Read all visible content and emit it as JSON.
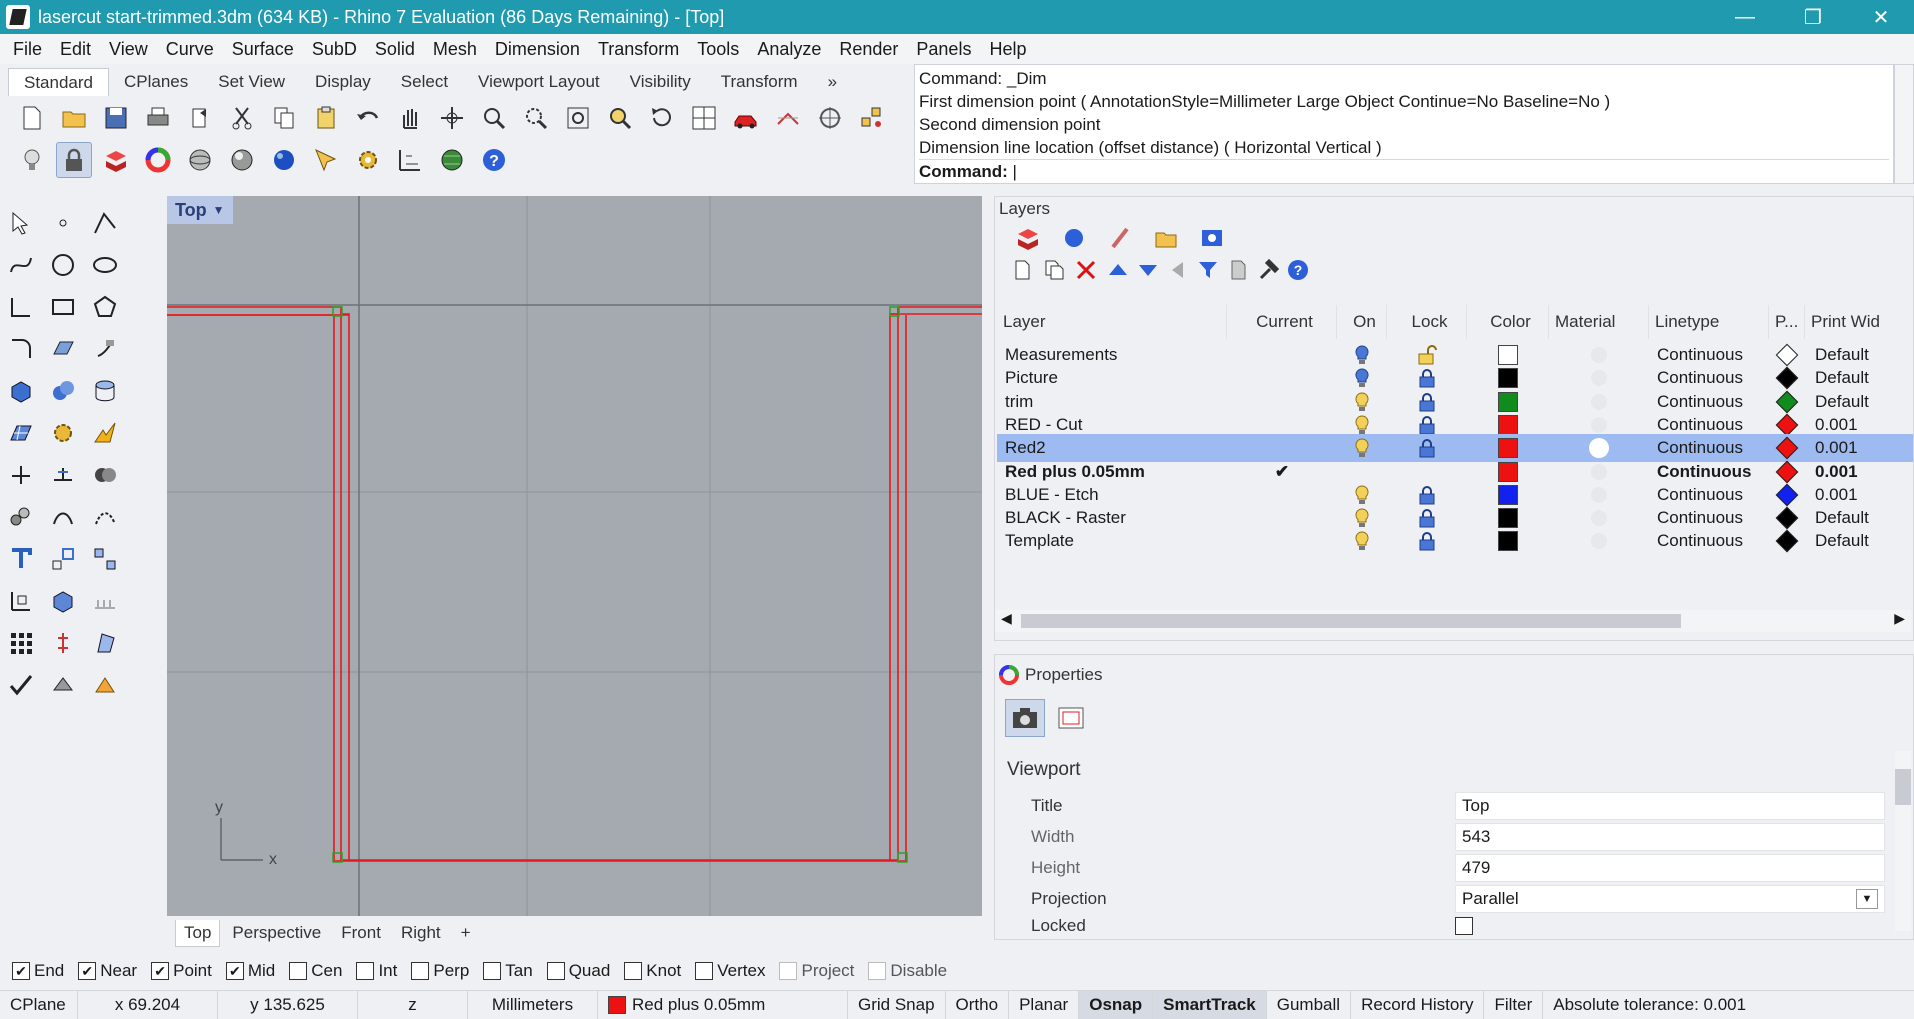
{
  "window": {
    "title": "lasercut start-trimmed.3dm (634 KB) - Rhino 7 Evaluation (86 Days Remaining) - [Top]",
    "min": "—",
    "restore": "❐",
    "close": "✕"
  },
  "menu": [
    "File",
    "Edit",
    "View",
    "Curve",
    "Surface",
    "SubD",
    "Solid",
    "Mesh",
    "Dimension",
    "Transform",
    "Tools",
    "Analyze",
    "Render",
    "Panels",
    "Help"
  ],
  "toolbar_tabs": [
    "Standard",
    "CPlanes",
    "Set View",
    "Display",
    "Select",
    "Viewport Layout",
    "Visibility",
    "Transform"
  ],
  "toolbar_overflow": "»",
  "command": {
    "history": [
      "Command: _Dim",
      "First dimension point ( AnnotationStyle=Millimeter Large  Object  Continue=No  Baseline=No )",
      "Second dimension point",
      "Dimension line location (offset distance) ( Horizontal  Vertical )"
    ],
    "prompt": "Command:"
  },
  "viewport": {
    "name": "Top",
    "axis_x": "x",
    "axis_y": "y"
  },
  "viewport_tabs": [
    "Top",
    "Perspective",
    "Front",
    "Right"
  ],
  "viewport_tab_add": "+",
  "layers": {
    "title": "Layers",
    "columns": [
      "Layer",
      "Current",
      "On",
      "Lock",
      "Color",
      "Material",
      "Linetype",
      "P...",
      "Print Wid"
    ],
    "rows": [
      {
        "name": "Measurements",
        "current": "",
        "on": "on-blue",
        "lock": "unlocked",
        "color": "#ffffff",
        "material": "",
        "linetype": "Continuous",
        "print_color": "#ffffff",
        "print_width": "Default"
      },
      {
        "name": "Picture",
        "current": "",
        "on": "on-blue",
        "lock": "locked",
        "color": "#000000",
        "material": "",
        "linetype": "Continuous",
        "print_color": "#000000",
        "print_width": "Default"
      },
      {
        "name": "trim",
        "current": "",
        "on": "on",
        "lock": "locked",
        "color": "#118a1e",
        "material": "",
        "linetype": "Continuous",
        "print_color": "#118a1e",
        "print_width": "Default"
      },
      {
        "name": "RED - Cut",
        "current": "",
        "on": "on",
        "lock": "locked",
        "color": "#ee1111",
        "material": "",
        "linetype": "Continuous",
        "print_color": "#ee1111",
        "print_width": "0.001"
      },
      {
        "name": "Red2",
        "current": "",
        "on": "on",
        "lock": "locked",
        "color": "#ee1111",
        "material": "white",
        "linetype": "Continuous",
        "print_color": "#ee1111",
        "print_width": "0.001"
      },
      {
        "name": "Red plus 0.05mm",
        "current": "✔",
        "on": "",
        "lock": "",
        "color": "#ee1111",
        "material": "",
        "linetype": "Continuous",
        "print_color": "#ee1111",
        "print_width": "0.001"
      },
      {
        "name": "BLUE - Etch",
        "current": "",
        "on": "on",
        "lock": "locked",
        "color": "#1122ee",
        "material": "",
        "linetype": "Continuous",
        "print_color": "#1122ee",
        "print_width": "0.001"
      },
      {
        "name": "BLACK - Raster",
        "current": "",
        "on": "on",
        "lock": "locked",
        "color": "#000000",
        "material": "",
        "linetype": "Continuous",
        "print_color": "#000000",
        "print_width": "Default"
      },
      {
        "name": "Template",
        "current": "",
        "on": "on",
        "lock": "locked",
        "color": "#000000",
        "material": "",
        "linetype": "Continuous",
        "print_color": "#000000",
        "print_width": "Default"
      }
    ]
  },
  "properties": {
    "title": "Properties",
    "section": "Viewport",
    "fields": [
      {
        "label": "Title",
        "value": "Top"
      },
      {
        "label": "Width",
        "value": "543"
      },
      {
        "label": "Height",
        "value": "479"
      },
      {
        "label": "Projection",
        "value": "Parallel"
      },
      {
        "label": "Locked",
        "value": ""
      }
    ]
  },
  "osnaps": [
    {
      "label": "End",
      "checked": true,
      "enabled": true
    },
    {
      "label": "Near",
      "checked": true,
      "enabled": true
    },
    {
      "label": "Point",
      "checked": true,
      "enabled": true
    },
    {
      "label": "Mid",
      "checked": true,
      "enabled": true
    },
    {
      "label": "Cen",
      "checked": false,
      "enabled": true
    },
    {
      "label": "Int",
      "checked": false,
      "enabled": true
    },
    {
      "label": "Perp",
      "checked": false,
      "enabled": true
    },
    {
      "label": "Tan",
      "checked": false,
      "enabled": true
    },
    {
      "label": "Quad",
      "checked": false,
      "enabled": true
    },
    {
      "label": "Knot",
      "checked": false,
      "enabled": true
    },
    {
      "label": "Vertex",
      "checked": false,
      "enabled": true
    },
    {
      "label": "Project",
      "checked": false,
      "enabled": false
    },
    {
      "label": "Disable",
      "checked": false,
      "enabled": false
    }
  ],
  "status": {
    "cplane": "CPlane",
    "x": "x 69.204",
    "y": "y 135.625",
    "z": "z",
    "units": "Millimeters",
    "layer": "Red plus 0.05mm",
    "layer_color": "#ee1111",
    "grid_snap": "Grid Snap",
    "ortho": "Ortho",
    "planar": "Planar",
    "osnap": "Osnap",
    "smarttrack": "SmartTrack",
    "gumball": "Gumball",
    "record_history": "Record History",
    "filter": "Filter",
    "tolerance": "Absolute tolerance: 0.001"
  },
  "colors": {
    "title_bar": "#1f9aae",
    "viewport_bg": "#a5aab1",
    "selection": "#9dbbf0",
    "curve_red": "#e8181d",
    "curve_green": "#2aa22a"
  }
}
